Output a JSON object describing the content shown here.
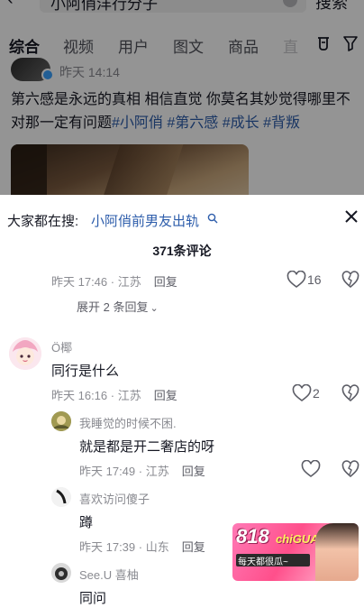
{
  "search": {
    "query": "小阿俏洋行分子",
    "submit_label": "搜索"
  },
  "tabs": [
    "综合",
    "视频",
    "用户",
    "图文",
    "商品",
    "直"
  ],
  "post": {
    "time": "昨天 14:14",
    "text": "第六感是永远的真相 相信直觉 你莫名其妙觉得哪里不对那一定有问题",
    "hashtags": [
      "#小阿俏",
      "#第六感",
      "#成长",
      "#背叛"
    ]
  },
  "sheet": {
    "hot_prefix": "大家都在搜:",
    "hot_query": "小阿俏前男友出轨",
    "comment_count": "371条评论"
  },
  "comments": {
    "c0": {
      "meta": "昨天 17:46 · 江苏",
      "reply": "回复",
      "likes": "16",
      "expand": "展开 2 条回复"
    },
    "c1": {
      "name": "Ö椰",
      "text": "同行是什么",
      "meta": "昨天 16:16 · 江苏",
      "reply": "回复",
      "likes": "2"
    },
    "r1": {
      "name": "我睡觉的时候不困.",
      "text": "就是都是开二奢店的呀",
      "meta": "昨天 17:49 · 江苏",
      "reply": "回复"
    },
    "r2": {
      "name": "喜欢访问傻子",
      "text": "蹲",
      "meta": "昨天 17:39 · 山东",
      "reply": "回复"
    },
    "r3": {
      "name": "See.U 喜柚",
      "text": "同问"
    }
  },
  "watermark": {
    "number": "818",
    "word": "chiGUA",
    "slogan": "每天都很瓜~"
  },
  "colors": {
    "link": "#2d5dab",
    "muted": "#8a8b91",
    "text": "#161823"
  }
}
